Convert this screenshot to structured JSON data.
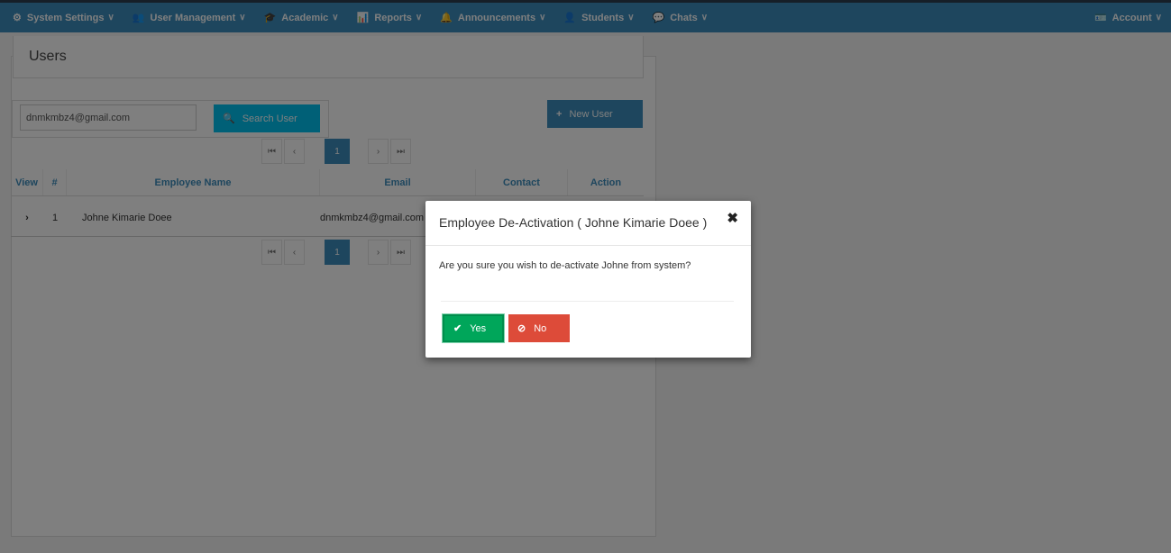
{
  "nav": {
    "items": [
      {
        "label": "System Settings",
        "icon": "gears-icon",
        "glyph": "⚙"
      },
      {
        "label": "User Management",
        "icon": "users-icon",
        "glyph": "👥"
      },
      {
        "label": "Academic",
        "icon": "graduation-cap-icon",
        "glyph": "🎓"
      },
      {
        "label": "Reports",
        "icon": "bar-chart-icon",
        "glyph": "📊"
      },
      {
        "label": "Announcements",
        "icon": "bell-icon",
        "glyph": "🔔"
      },
      {
        "label": "Students",
        "icon": "student-icon",
        "glyph": "👤"
      },
      {
        "label": "Chats",
        "icon": "chat-icon",
        "glyph": "💬"
      }
    ],
    "account": {
      "label": "Account",
      "icon": "id-card-icon",
      "glyph": "🪪"
    },
    "chevron": "∨"
  },
  "page": {
    "title": "Users"
  },
  "search": {
    "value": "dnmkmbz4@gmail.com",
    "button_label": "Search User",
    "button_icon": "🔍"
  },
  "new_user": {
    "label": "New User",
    "icon": "+"
  },
  "pagination": {
    "first": "⏮",
    "prev": "‹",
    "page": "1",
    "next": "›",
    "last": "⏭"
  },
  "table": {
    "headers": [
      "View",
      "#",
      "Employee Name",
      "Email",
      "Contact",
      "Action"
    ],
    "rows": [
      {
        "view": "›",
        "num": "1",
        "name": "Johne Kimarie Doee",
        "email": "dnmkmbz4@gmail.com"
      }
    ]
  },
  "modal": {
    "title": "Employee De-Activation ( Johne Kimarie Doee )",
    "close": "✖",
    "body": "Are you sure you wish to de-activate Johne from system?",
    "yes_label": "Yes",
    "yes_icon": "✔",
    "no_label": "No",
    "no_icon": "⊘"
  },
  "colors": {
    "nav": "#3c8dbc",
    "primary": "#3c8dbc",
    "info": "#00c0ef",
    "success": "#00a65a",
    "danger": "#dd4b39"
  }
}
